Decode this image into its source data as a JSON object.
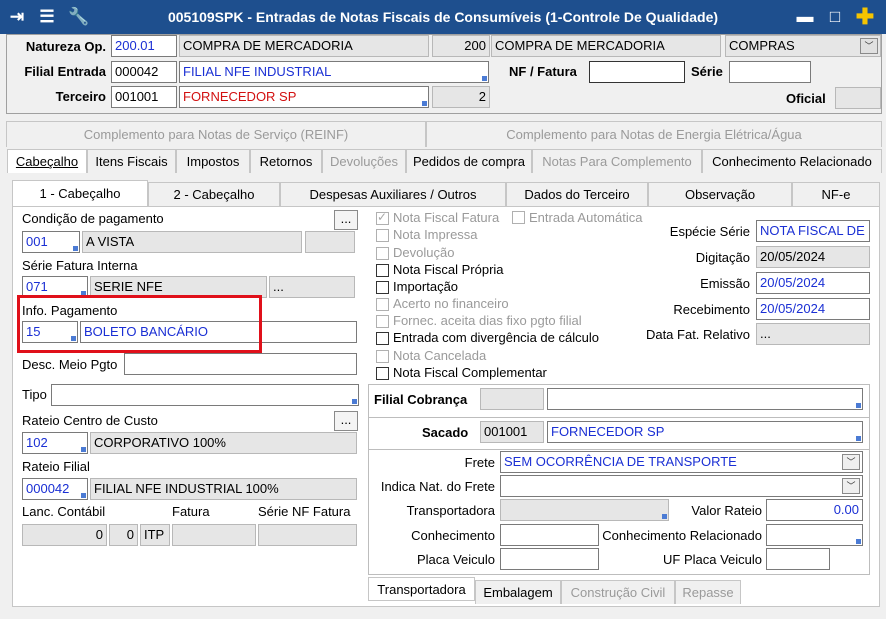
{
  "window": {
    "title": "005109SPK - Entradas de Notas Fiscais de Consumíveis (1-Controle De Qualidade)"
  },
  "header": {
    "natureza_label": "Natureza Op.",
    "natureza_code": "200.01",
    "natureza_desc": "COMPRA DE MERCADORIA",
    "natureza_code2": "200",
    "natureza_desc2": "COMPRA DE MERCADORIA",
    "natureza_tipo": "COMPRAS",
    "filial_label": "Filial Entrada",
    "filial_code": "000042",
    "filial_desc": "FILIAL NFE INDUSTRIAL",
    "nf_label": "NF / Fatura",
    "nf_value": "",
    "serie_label": "Série",
    "serie_value": "",
    "terceiro_label": "Terceiro",
    "terceiro_code": "001001",
    "terceiro_desc": "FORNECEDOR SP",
    "terceiro_num": "2",
    "oficial_label": "Oficial",
    "oficial_value": ""
  },
  "top_tabs": {
    "reinf": "Complemento para Notas de Serviço (REINF)",
    "energia": "Complemento para Notas de Energia Elétrica/Água"
  },
  "main_tabs": [
    "Cabeçalho",
    "Itens Fiscais",
    "Impostos",
    "Retornos",
    "Devoluções",
    "Pedidos de compra",
    "Notas Para Complemento",
    "Conhecimento Relacionado"
  ],
  "sub_tabs": [
    "1 - Cabeçalho",
    "2 - Cabeçalho",
    "Despesas Auxiliares / Outros",
    "Dados do Terceiro",
    "Observação",
    "NF-e"
  ],
  "left": {
    "cond_pag_label": "Condição de pagamento",
    "cond_pag_code": "001",
    "cond_pag_desc": "A VISTA",
    "serie_fatura_label": "Série Fatura Interna",
    "serie_fatura_code": "071",
    "serie_fatura_desc": "SERIE NFE",
    "info_pag_label": "Info. Pagamento",
    "info_pag_code": "15",
    "info_pag_desc": "BOLETO BANCÁRIO",
    "desc_meio_label": "Desc. Meio Pgto",
    "tipo_label": "Tipo",
    "rateio_cc_label": "Rateio Centro de Custo",
    "rateio_cc_code": "102",
    "rateio_cc_desc": "CORPORATIVO 100%",
    "rateio_filial_label": "Rateio Filial",
    "rateio_filial_code": "000042",
    "rateio_filial_desc": "FILIAL NFE INDUSTRIAL 100%",
    "lanc_label": "Lanc. Contábil",
    "fatura_label": "Fatura",
    "serie_nf_label": "Série NF Fatura",
    "lanc_v1": "0",
    "lanc_v2": "0",
    "lanc_v3": "ITP",
    "ellipsis": "..."
  },
  "checks": [
    {
      "label": "Nota Fiscal Fatura",
      "checked": true,
      "enabled": false
    },
    {
      "label": "Nota Impressa",
      "checked": false,
      "enabled": false
    },
    {
      "label": "Devolução",
      "checked": false,
      "enabled": false
    },
    {
      "label": "Nota Fiscal Própria",
      "checked": false,
      "enabled": true
    },
    {
      "label": "Importação",
      "checked": false,
      "enabled": true
    },
    {
      "label": "Acerto no financeiro",
      "checked": false,
      "enabled": false
    },
    {
      "label": "Fornec. aceita dias fixo pgto filial",
      "checked": false,
      "enabled": false
    },
    {
      "label": "Entrada com divergência de cálculo",
      "checked": false,
      "enabled": true
    },
    {
      "label": "Nota Cancelada",
      "checked": false,
      "enabled": false
    },
    {
      "label": "Nota Fiscal Complementar",
      "checked": false,
      "enabled": true
    }
  ],
  "entrada_auto_label": "Entrada Automática",
  "right": {
    "especie_label": "Espécie Série",
    "especie_value": "NOTA FISCAL DE S",
    "digitacao_label": "Digitação",
    "digitacao_value": "20/05/2024",
    "emissao_label": "Emissão",
    "emissao_value": "20/05/2024",
    "recebimento_label": "Recebimento",
    "recebimento_value": "20/05/2024",
    "data_fat_label": "Data Fat. Relativo",
    "data_fat_value": "..."
  },
  "cobranca": {
    "filial_label": "Filial Cobrança",
    "sacado_label": "Sacado",
    "sacado_code": "001001",
    "sacado_desc": "FORNECEDOR SP"
  },
  "transporte": {
    "frete_label": "Frete",
    "frete_value": "SEM OCORRÊNCIA DE TRANSPORTE",
    "indica_label": "Indica Nat. do Frete",
    "transportadora_label": "Transportadora",
    "valor_rateio_label": "Valor Rateio",
    "valor_rateio_value": "0.00",
    "conhecimento_label": "Conhecimento",
    "conh_rel_label": "Conhecimento Relacionado",
    "placa_label": "Placa Veiculo",
    "uf_placa_label": "UF Placa Veiculo"
  },
  "bottom_tabs": [
    "Transportadora",
    "Embalagem",
    "Construção Civil",
    "Repasse"
  ],
  "colors": {
    "title_bar": "#1e4f8e",
    "blue_text": "#1a2fd4",
    "red_text": "#d21010",
    "highlight": "#e0101a"
  }
}
